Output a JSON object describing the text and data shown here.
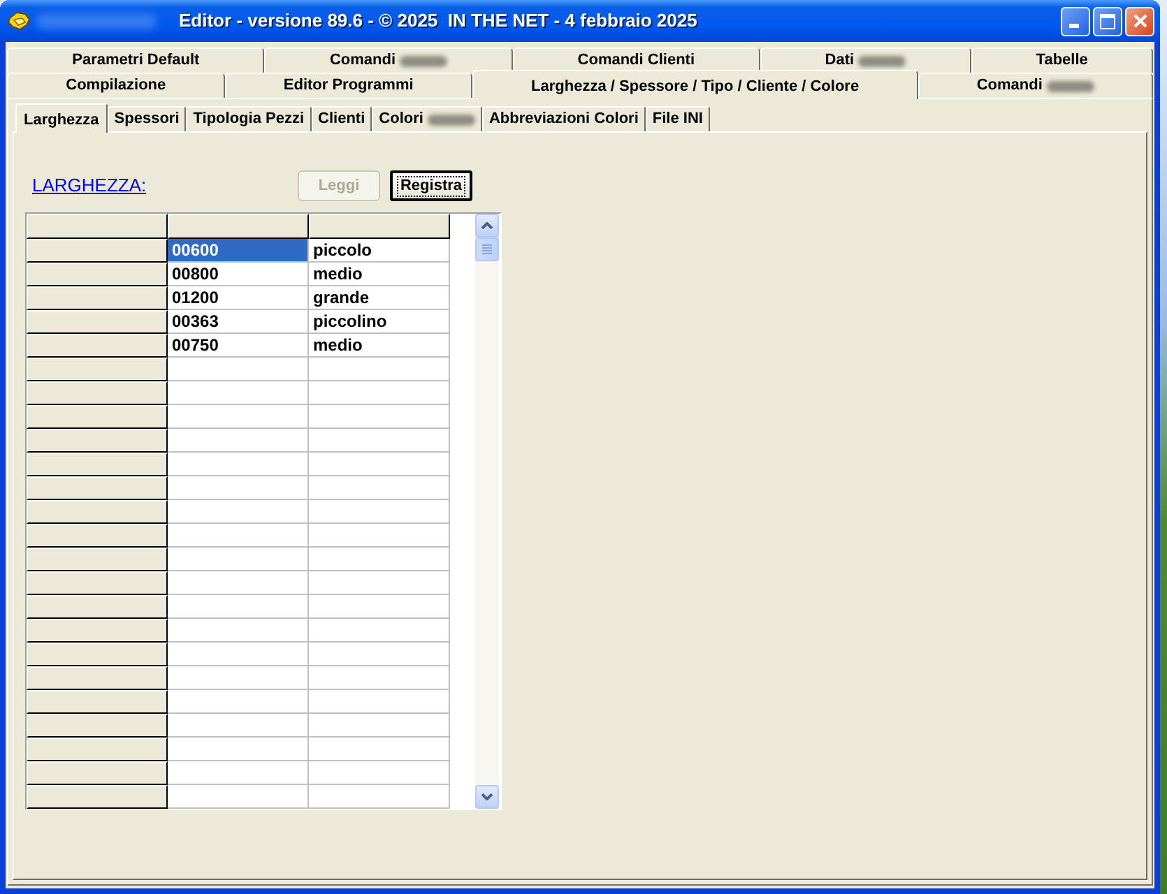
{
  "window": {
    "title": "Editor - versione 89.6 - © 2025  IN THE NET - 4 febbraio 2025",
    "blurred_prefix": true
  },
  "tab_rows": [
    {
      "tabs": [
        {
          "label": "Parametri Default",
          "selected": false,
          "blurred": false
        },
        {
          "label": "Comandi",
          "selected": false,
          "blurred": true
        },
        {
          "label": "Comandi Clienti",
          "selected": false,
          "blurred": false
        },
        {
          "label": "Dati",
          "selected": false,
          "blurred": true
        },
        {
          "label": "Tabelle",
          "selected": false,
          "blurred": false
        }
      ]
    },
    {
      "tabs": [
        {
          "label": "Compilazione",
          "selected": false,
          "blurred": false
        },
        {
          "label": "Editor Programmi",
          "selected": false,
          "blurred": false
        },
        {
          "label": "Larghezza / Spessore / Tipo / Cliente / Colore",
          "selected": true,
          "blurred": false
        },
        {
          "label": "Comandi",
          "selected": false,
          "blurred": true
        }
      ]
    }
  ],
  "sub_tabs": [
    {
      "label": "Larghezza",
      "selected": true,
      "blurred": false
    },
    {
      "label": "Spessori",
      "selected": false,
      "blurred": false
    },
    {
      "label": "Tipologia Pezzi",
      "selected": false,
      "blurred": false
    },
    {
      "label": "Clienti",
      "selected": false,
      "blurred": false
    },
    {
      "label": "Colori",
      "selected": false,
      "blurred": true
    },
    {
      "label": "Abbreviazioni Colori",
      "selected": false,
      "blurred": false
    },
    {
      "label": "File INI",
      "selected": false,
      "blurred": false
    }
  ],
  "section_link": {
    "text": "LARGHEZZA:"
  },
  "buttons": [
    {
      "label": "Leggi",
      "disabled": true,
      "focused": false
    },
    {
      "label": "Registra",
      "disabled": false,
      "focused": true
    }
  ],
  "grid": {
    "rows": [
      {
        "cells": [
          {
            "text": "00600",
            "selected": true
          },
          {
            "text": "piccolo",
            "selected": false
          }
        ]
      },
      {
        "cells": [
          {
            "text": "00800",
            "selected": false
          },
          {
            "text": "medio",
            "selected": false
          }
        ]
      },
      {
        "cells": [
          {
            "text": "01200",
            "selected": false
          },
          {
            "text": "grande",
            "selected": false
          }
        ]
      },
      {
        "cells": [
          {
            "text": "00363",
            "selected": false
          },
          {
            "text": "piccolino",
            "selected": false
          }
        ]
      },
      {
        "cells": [
          {
            "text": "00750",
            "selected": false
          },
          {
            "text": "medio",
            "selected": false
          }
        ]
      }
    ]
  }
}
